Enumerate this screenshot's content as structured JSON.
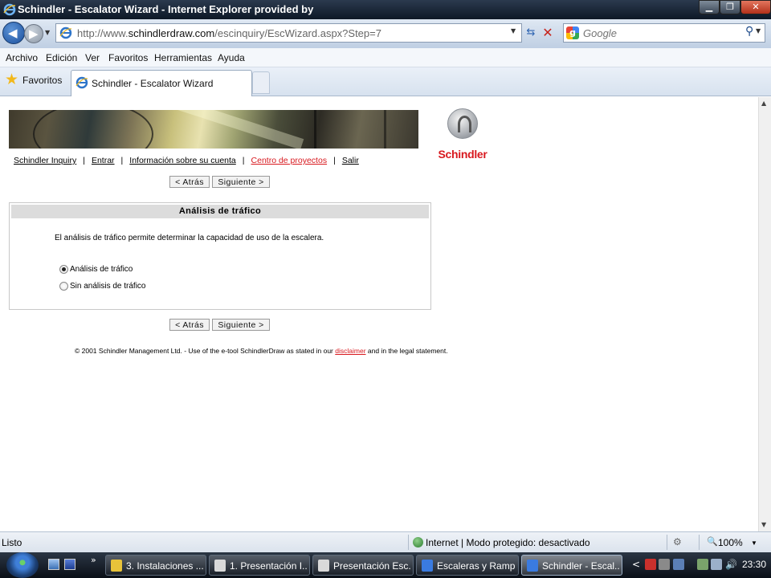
{
  "window": {
    "title": "Schindler - Escalator Wizard - Internet Explorer provided by",
    "minimize": "▁",
    "maximize": "❐",
    "close": "✕"
  },
  "address_bar": {
    "url_prefix": "http://www.",
    "url_domain": "schindlerdraw.com",
    "url_path": "/escinquiry/EscWizard.aspx?Step=7"
  },
  "search": {
    "placeholder": "Google",
    "engine_letter": "g"
  },
  "menu": [
    "Archivo",
    "Edición",
    "Ver",
    "Favoritos",
    "Herramientas",
    "Ayuda"
  ],
  "favorites_label": "Favoritos",
  "tab": {
    "title": "Schindler - Escalator Wizard"
  },
  "logo": {
    "text": "Schindler"
  },
  "nav_links": {
    "inquiry": "Schindler Inquiry",
    "entrar": "Entrar",
    "cuenta": "Información sobre su cuenta",
    "proyectos": "Centro de proyectos",
    "salir": "Salir",
    "separator": "|"
  },
  "wizard": {
    "back_label": "< Atrás",
    "next_label": "Siguiente >",
    "panel_title": "Análisis de tráfico",
    "description": "El análisis de tráfico permite determinar la capacidad de uso de la escalera.",
    "options": [
      {
        "label": "Análisis de tráfico",
        "selected": true
      },
      {
        "label": "Sin análisis de tráfico",
        "selected": false
      }
    ]
  },
  "footer": {
    "copyright_pre": "© 2001 Schindler Management Ltd. - Use of the e-tool SchindlerDraw as stated in our",
    "disclaimer": "disclaimer",
    "copyright_post": "and in the legal statement."
  },
  "status_bar": {
    "status": "Listo",
    "zone": "Internet | Modo protegido: desactivado",
    "zoom": "100%"
  },
  "taskbar": {
    "more": "»",
    "buttons": [
      {
        "label": "3. Instalaciones ...",
        "icon_color": "#e8c33a",
        "active": false
      },
      {
        "label": "1. Presentación I...",
        "icon_color": "#d9d9d9",
        "active": false
      },
      {
        "label": "Presentación Esc...",
        "icon_color": "#d9d9d9",
        "active": false
      },
      {
        "label": "Escaleras y Ramp...",
        "icon_color": "#3a7be0",
        "active": false
      },
      {
        "label": "Schindler - Escal...",
        "icon_color": "#3a7be0",
        "active": true
      }
    ],
    "tray_arrow": "<",
    "clock": "23:30"
  },
  "colors": {
    "brand_red": "#d8191f",
    "link_black": "#000000"
  }
}
